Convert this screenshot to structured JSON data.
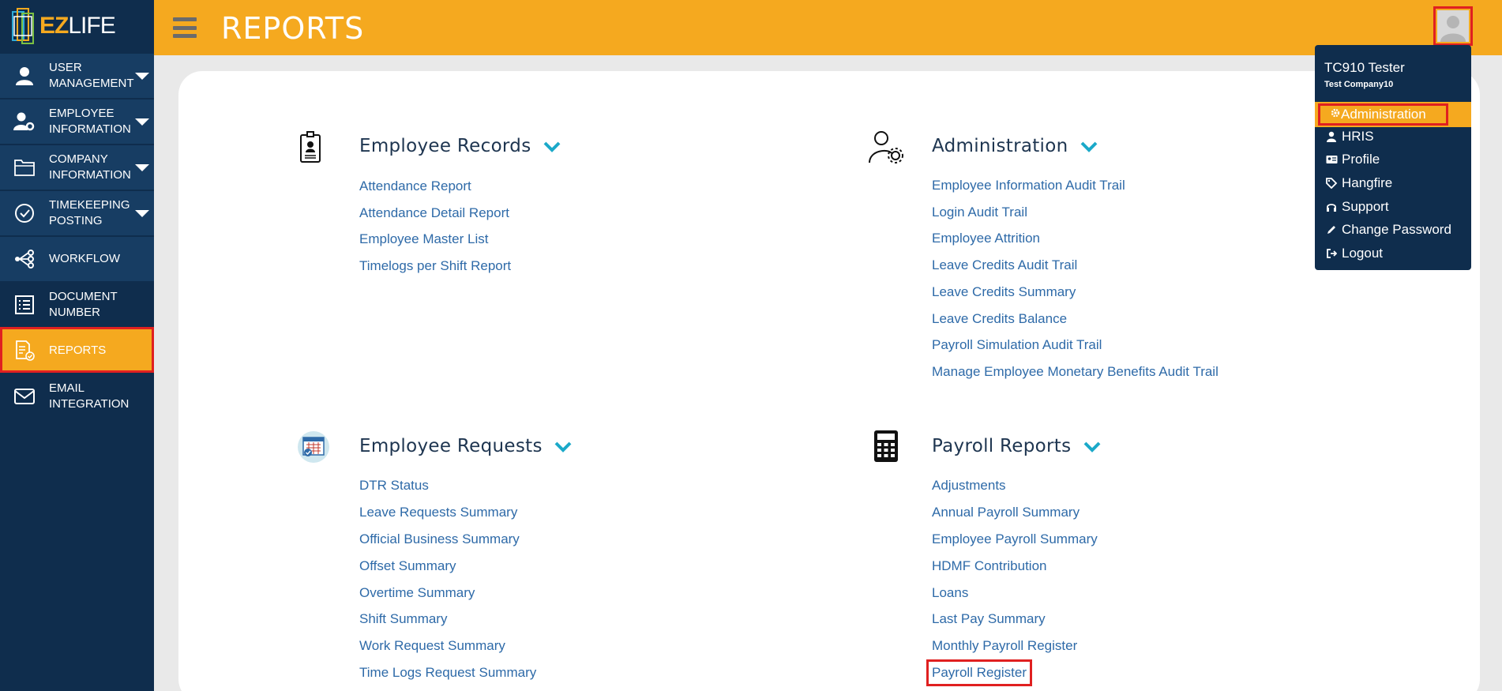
{
  "app": {
    "logo_ez": "EZ",
    "logo_life": "LIFE"
  },
  "header": {
    "title": "REPORTS"
  },
  "sidebar": {
    "items": [
      {
        "line1": "USER",
        "line2": "MANAGEMENT",
        "icon": "user-icon"
      },
      {
        "line1": "EMPLOYEE",
        "line2": "INFORMATION",
        "icon": "user-gear-icon"
      },
      {
        "line1": "COMPANY",
        "line2": "INFORMATION",
        "icon": "folder-icon"
      },
      {
        "line1": "TIMEKEEPING",
        "line2": "POSTING",
        "icon": "check-circle-icon"
      },
      {
        "line1": "WORKFLOW",
        "line2": "",
        "icon": "workflow-icon"
      },
      {
        "line1": "DOCUMENT",
        "line2": "NUMBER",
        "icon": "list-icon"
      },
      {
        "line1": "REPORTS",
        "line2": "",
        "icon": "report-icon"
      },
      {
        "line1": "EMAIL",
        "line2": "INTEGRATION",
        "icon": "mail-icon"
      }
    ]
  },
  "sections": {
    "employee_records": {
      "title": "Employee Records",
      "links": [
        "Attendance Report",
        "Attendance Detail Report",
        "Employee Master List",
        "Timelogs per Shift Report"
      ]
    },
    "administration": {
      "title": "Administration",
      "links": [
        "Employee Information Audit Trail",
        "Login Audit Trail",
        "Employee Attrition",
        "Leave Credits Audit Trail",
        "Leave Credits Summary",
        "Leave Credits Balance",
        "Payroll Simulation Audit Trail",
        "Manage Employee Monetary Benefits Audit Trail"
      ]
    },
    "employee_requests": {
      "title": "Employee Requests",
      "links": [
        "DTR Status",
        "Leave Requests Summary",
        "Official Business Summary",
        "Offset Summary",
        "Overtime Summary",
        "Shift Summary",
        "Work Request Summary",
        "Time Logs Request Summary"
      ]
    },
    "payroll_reports": {
      "title": "Payroll Reports",
      "links": [
        "Adjustments",
        "Annual Payroll Summary",
        "Employee Payroll Summary",
        "HDMF Contribution",
        "Loans",
        "Last Pay Summary",
        "Monthly Payroll Register",
        "Payroll Register"
      ]
    }
  },
  "user_menu": {
    "name": "TC910 Tester",
    "company": "Test Company10",
    "items": [
      "Administration",
      "HRIS",
      "Profile",
      "Hangfire",
      "Support",
      "Change Password",
      "Logout"
    ]
  },
  "colors": {
    "accent": "#f5a91f",
    "sidebar": "#0f2d4d",
    "link": "#2e6aa8",
    "highlight": "#e02020",
    "chevron": "#1ba9c9"
  }
}
